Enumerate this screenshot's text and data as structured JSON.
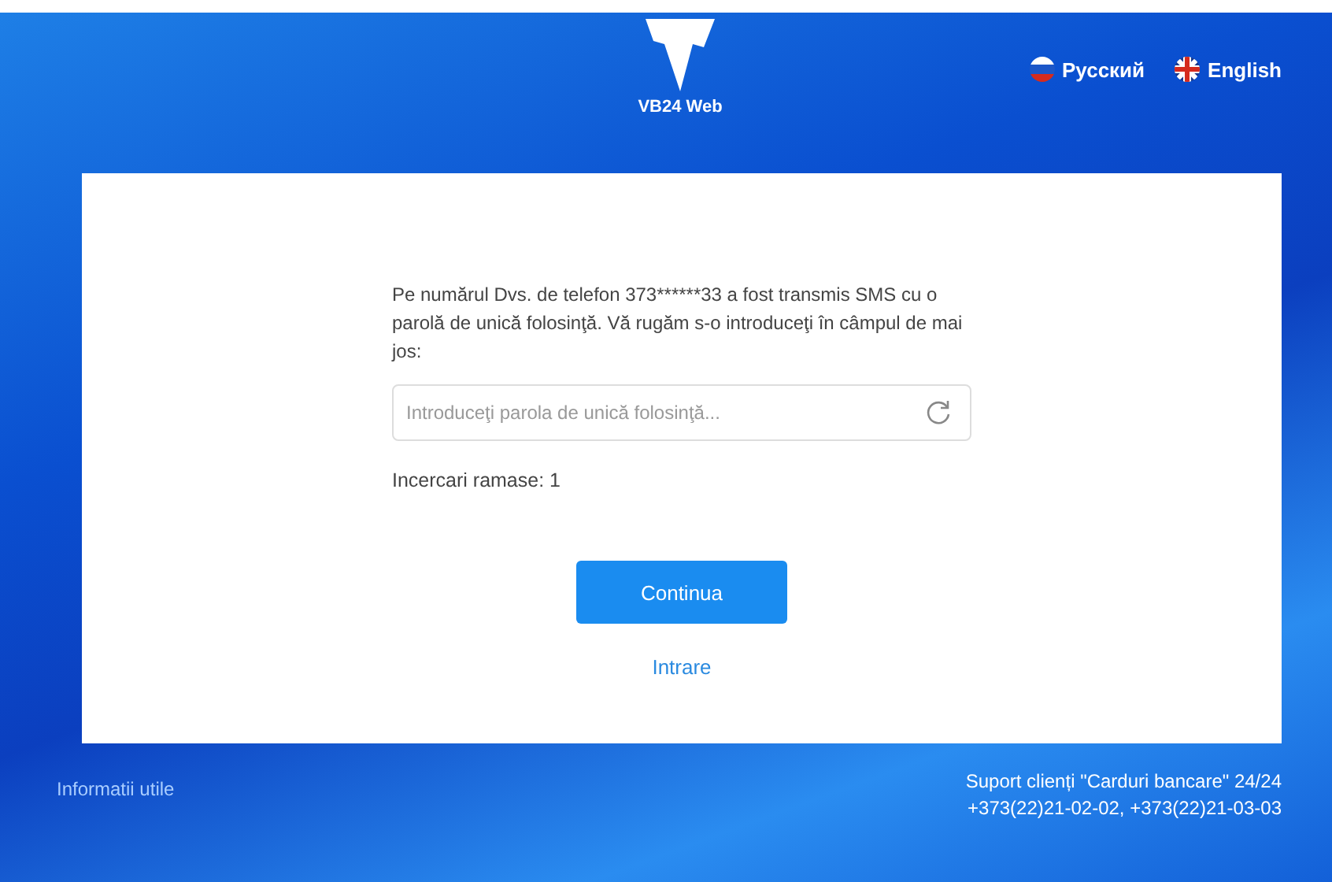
{
  "header": {
    "logo_text": "VB24 Web",
    "languages": [
      {
        "label": "Русский",
        "kind": "ru"
      },
      {
        "label": "English",
        "kind": "en"
      }
    ]
  },
  "card": {
    "message": "Pe numărul Dvs. de telefon 373******33 a fost transmis SMS cu o parolă de unică folosinţă. Vă rugăm s-o introduceţi în câmpul de mai jos:",
    "otp_field": {
      "placeholder": "Introduceţi parola de unică folosinţă..."
    },
    "attempts": "Incercari ramase: 1",
    "continue_button": "Continua",
    "login_link": "Intrare"
  },
  "footer": {
    "info_link": "Informatii utile",
    "support": [
      "Suport clienți \"Carduri bancare\" 24/24",
      "+373(22)21-02-02, +373(22)21-03-03"
    ]
  }
}
